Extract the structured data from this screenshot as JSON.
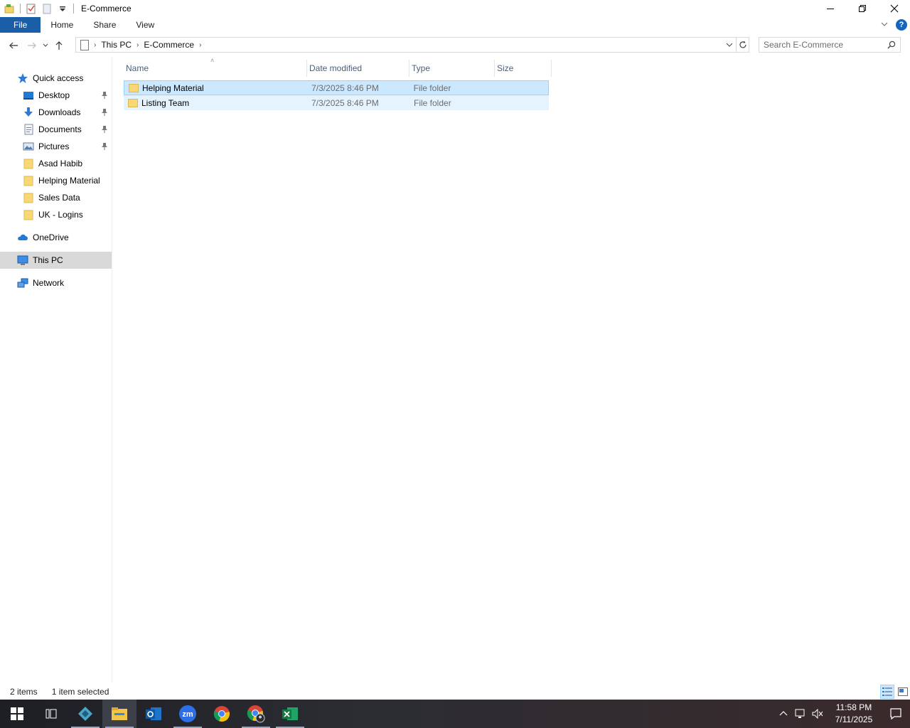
{
  "window": {
    "title": "E-Commerce"
  },
  "ribbon": {
    "tabs": [
      "File",
      "Home",
      "Share",
      "View"
    ]
  },
  "address": {
    "crumbs": [
      "This PC",
      "E-Commerce"
    ]
  },
  "search": {
    "placeholder": "Search E-Commerce"
  },
  "nav": {
    "quick_access": "Quick access",
    "pinned": [
      {
        "label": "Desktop",
        "icon": "desktop-icon"
      },
      {
        "label": "Downloads",
        "icon": "download-icon"
      },
      {
        "label": "Documents",
        "icon": "document-icon"
      },
      {
        "label": "Pictures",
        "icon": "pictures-icon"
      }
    ],
    "folders": [
      "Asad Habib",
      "Helping Material",
      "Sales Data",
      "UK - Logins"
    ],
    "onedrive": "OneDrive",
    "this_pc": "This PC",
    "network": "Network"
  },
  "columns": {
    "name": "Name",
    "date": "Date modified",
    "type": "Type",
    "size": "Size"
  },
  "files": [
    {
      "name": "Helping Material",
      "date": "7/3/2025 8:46 PM",
      "type": "File folder",
      "size": ""
    },
    {
      "name": "Listing Team",
      "date": "7/3/2025 8:46 PM",
      "type": "File folder",
      "size": ""
    }
  ],
  "status": {
    "count": "2 items",
    "selected": "1 item selected"
  },
  "clock": {
    "time": "11:58 PM",
    "date": "7/11/2025"
  },
  "colors": {
    "file_tab": "#1a5ea8",
    "selection": "#cce8ff",
    "folder": "#f8d775"
  }
}
